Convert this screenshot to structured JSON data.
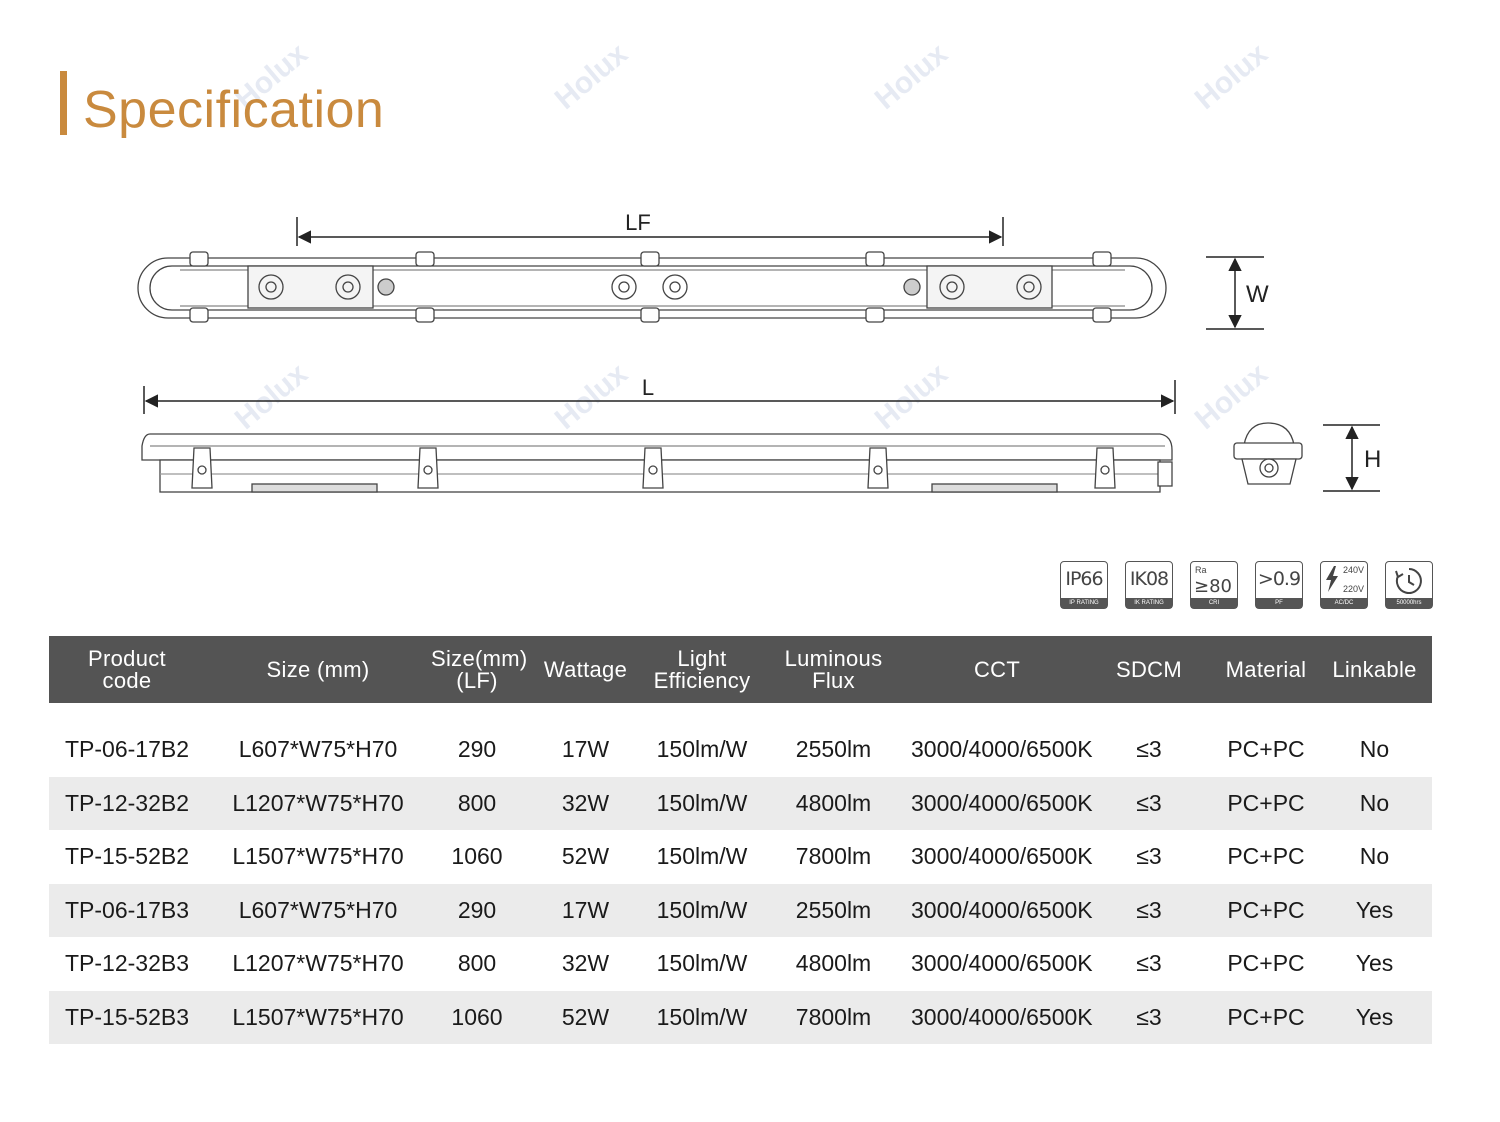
{
  "title": "Specification",
  "watermark": "Holux",
  "drawing": {
    "lf_label": "LF",
    "l_label": "L",
    "w_label": "W",
    "h_label": "H"
  },
  "badges": [
    {
      "icon": "ip66-icon",
      "main": "IP66",
      "caption": "IP RATING"
    },
    {
      "icon": "ik08-icon",
      "main": "IK08",
      "caption": "IK RATING"
    },
    {
      "icon": "cri-icon",
      "top": "Ra",
      "main": "≥80",
      "caption": "CRI"
    },
    {
      "icon": "power-factor-icon",
      "main": ">0.9",
      "caption": "PF"
    },
    {
      "icon": "voltage-icon",
      "v1": "240V",
      "v2": "220V",
      "caption": "AC/DC"
    },
    {
      "icon": "lifetime-icon",
      "caption": "50000hrs"
    }
  ],
  "table": {
    "headers": [
      {
        "line1": "Product",
        "line2": "code"
      },
      {
        "line1": "Size (mm)",
        "line2": ""
      },
      {
        "line1": "Size(mm)",
        "line2": "(LF)"
      },
      {
        "line1": "Wattage",
        "line2": ""
      },
      {
        "line1": "Light",
        "line2": "Efficiency"
      },
      {
        "line1": "Luminous",
        "line2": "Flux"
      },
      {
        "line1": "CCT",
        "line2": ""
      },
      {
        "line1": "SDCM",
        "line2": ""
      },
      {
        "line1": "Material",
        "line2": ""
      },
      {
        "line1": "Linkable",
        "line2": ""
      }
    ],
    "rows": [
      [
        "TP-06-17B2",
        "L607*W75*H70",
        "290",
        "17W",
        "150lm/W",
        "2550lm",
        "3000/4000/6500K",
        "≤3",
        "PC+PC",
        "No"
      ],
      [
        "TP-12-32B2",
        "L1207*W75*H70",
        "800",
        "32W",
        "150lm/W",
        "4800lm",
        "3000/4000/6500K",
        "≤3",
        "PC+PC",
        "No"
      ],
      [
        "TP-15-52B2",
        "L1507*W75*H70",
        "1060",
        "52W",
        "150lm/W",
        "7800lm",
        "3000/4000/6500K",
        "≤3",
        "PC+PC",
        "No"
      ],
      [
        "TP-06-17B3",
        "L607*W75*H70",
        "290",
        "17W",
        "150lm/W",
        "2550lm",
        "3000/4000/6500K",
        "≤3",
        "PC+PC",
        "Yes"
      ],
      [
        "TP-12-32B3",
        "L1207*W75*H70",
        "800",
        "32W",
        "150lm/W",
        "4800lm",
        "3000/4000/6500K",
        "≤3",
        "PC+PC",
        "Yes"
      ],
      [
        "TP-15-52B3",
        "L1507*W75*H70",
        "1060",
        "52W",
        "150lm/W",
        "7800lm",
        "3000/4000/6500K",
        "≤3",
        "PC+PC",
        "Yes"
      ]
    ]
  },
  "colors": {
    "accent": "#c98a3e",
    "header_bg": "#545454",
    "stripe_bg": "#ebebeb"
  }
}
